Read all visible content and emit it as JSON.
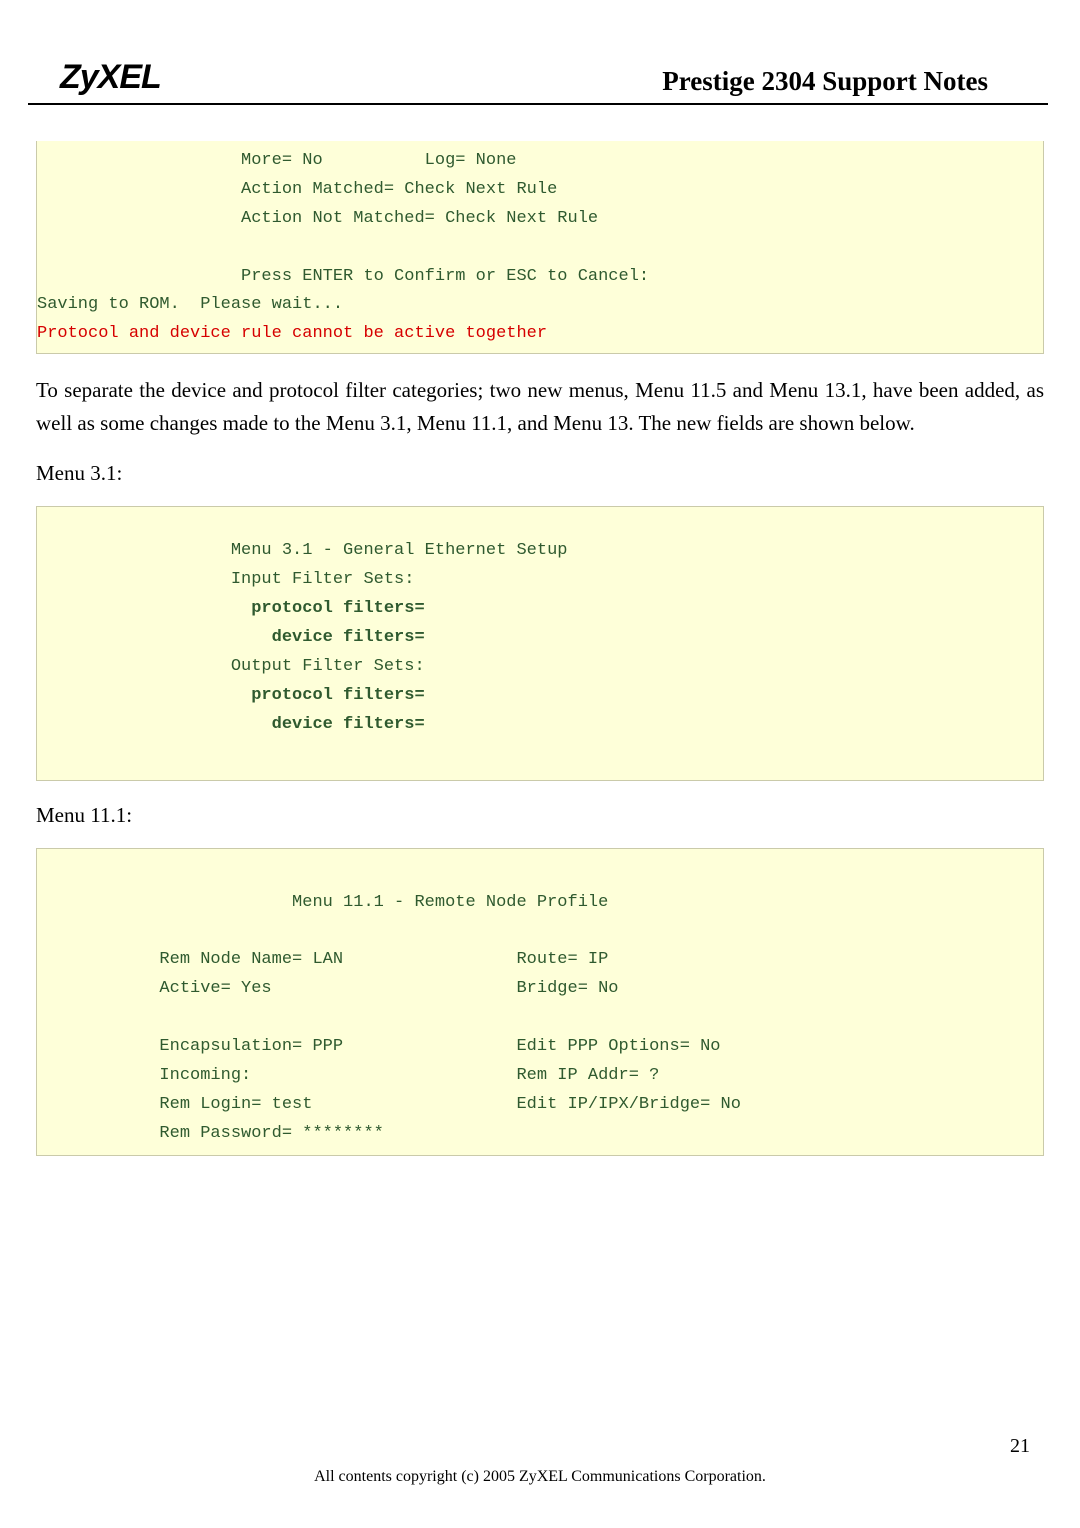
{
  "header": {
    "logo": "ZyXEL",
    "title": "Prestige 2304 Support Notes"
  },
  "box1": {
    "l1": "                    More= No          Log= None",
    "l2": "                    Action Matched= Check Next Rule",
    "l3": "                    Action Not Matched= Check Next Rule",
    "l4": " ",
    "l5": "                    Press ENTER to Confirm or ESC to Cancel:",
    "l6": "Saving to ROM.  Please wait...",
    "l7": "Protocol and device rule cannot be active together"
  },
  "para1": "To separate the device and protocol filter categories; two new menus, Menu 11.5 and Menu 13.1, have been added, as well as some changes made to the Menu 3.1, Menu 11.1, and Menu 13. The new fields are shown below.",
  "label1": "Menu 3.1:",
  "box2": {
    "l1": "                   Menu 3.1 - General Ethernet Setup",
    "l2": "                   Input Filter Sets:",
    "l3": "                     protocol filters=",
    "l4": "                       device filters=",
    "l5": "                   Output Filter Sets:",
    "l6": "                     protocol filters=",
    "l7": "                       device filters="
  },
  "label2": "Menu 11.1:",
  "box3": {
    "l1": "                         Menu 11.1 - Remote Node Profile",
    "l2": " ",
    "l3": "            Rem Node Name= LAN                 Route= IP",
    "l4": "            Active= Yes                        Bridge= No",
    "l5": " ",
    "l6": "            Encapsulation= PPP                 Edit PPP Options= No",
    "l7": "            Incoming:                          Rem IP Addr= ?",
    "l8": "            Rem Login= test                    Edit IP/IPX/Bridge= No",
    "l9": "            Rem Password= ********"
  },
  "footer": "All contents copyright (c) 2005 ZyXEL Communications Corporation.",
  "page": "21"
}
